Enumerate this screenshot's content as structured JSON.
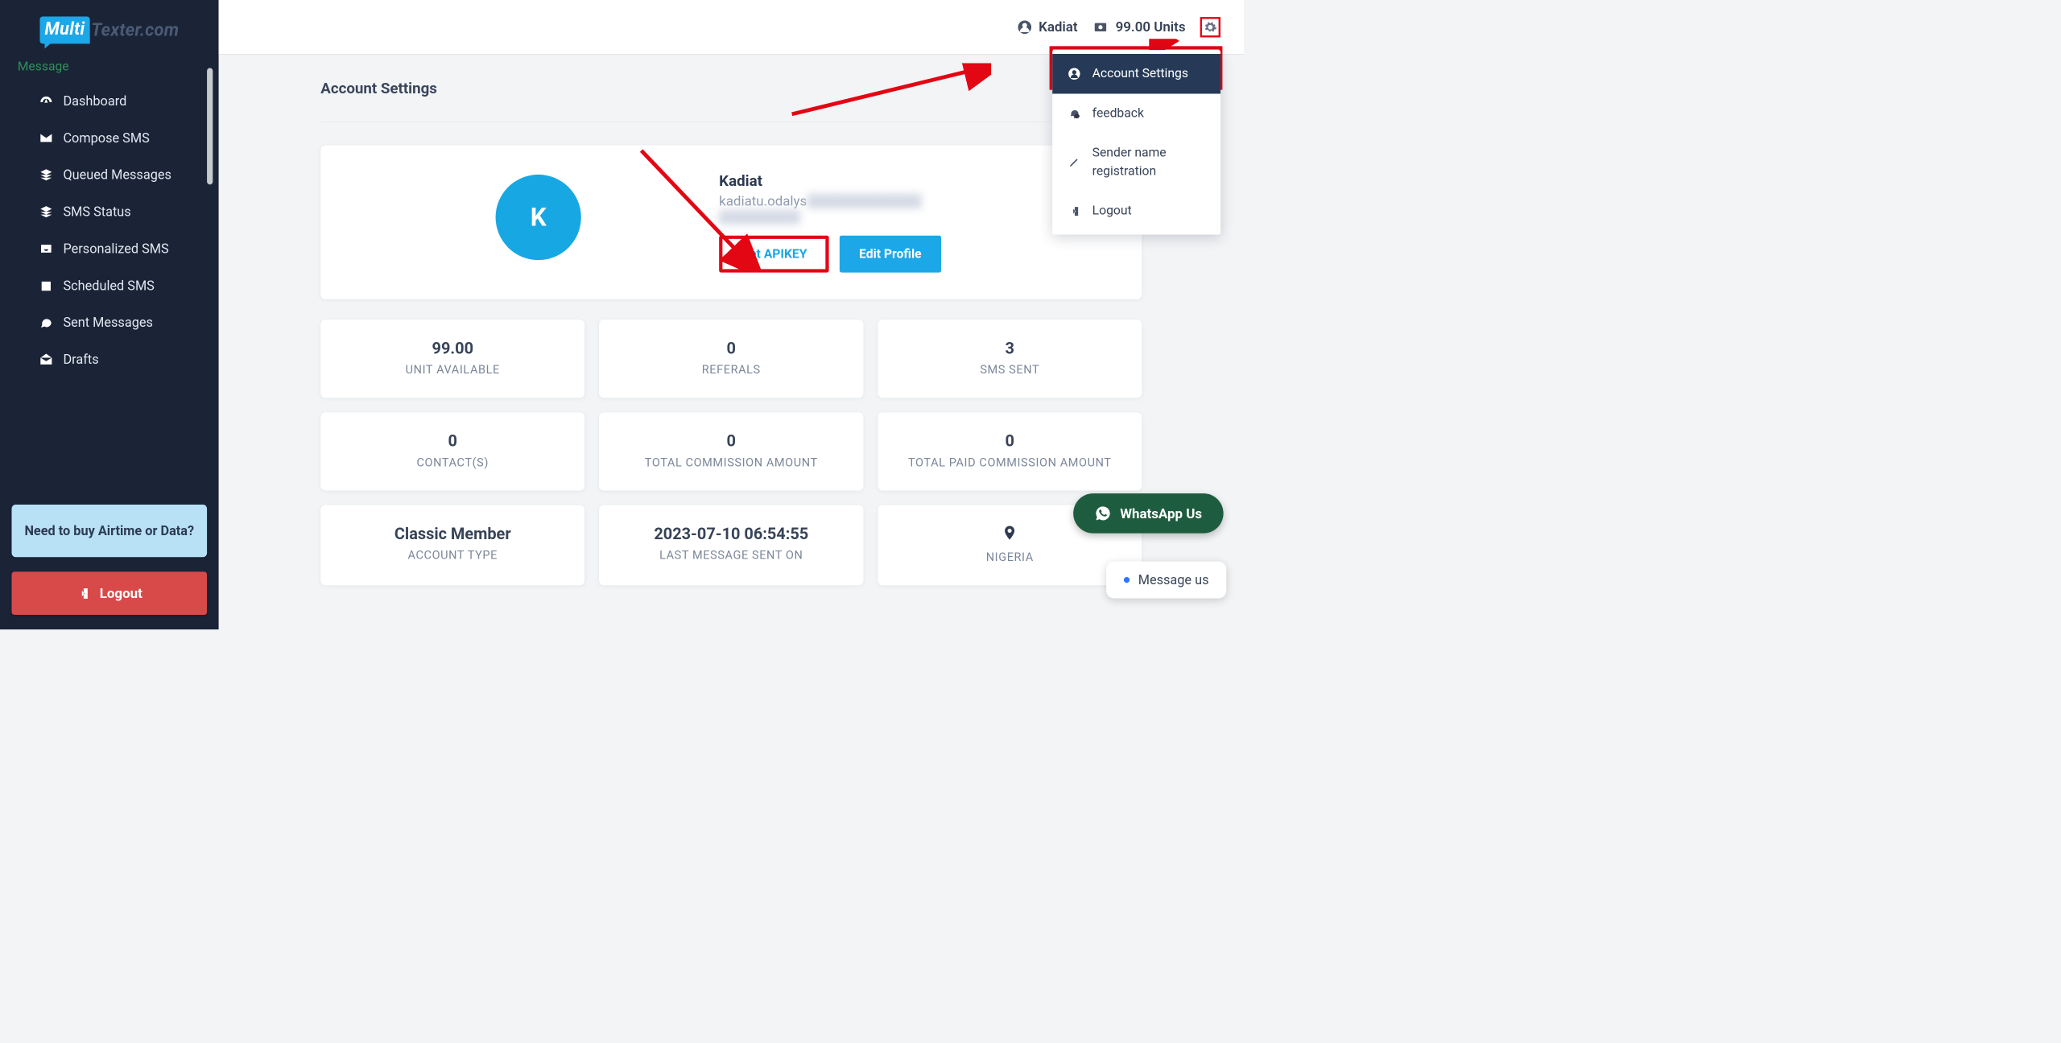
{
  "logo": {
    "left": "Multi",
    "right": "Texter.com"
  },
  "sidebar": {
    "section": "Message",
    "items": [
      {
        "icon": "gauge",
        "label": "Dashboard"
      },
      {
        "icon": "envelope",
        "label": "Compose SMS"
      },
      {
        "icon": "layers",
        "label": "Queued Messages"
      },
      {
        "icon": "layers",
        "label": "SMS Status"
      },
      {
        "icon": "inbox",
        "label": "Personalized SMS"
      },
      {
        "icon": "calendar",
        "label": "Scheduled SMS"
      },
      {
        "icon": "comment",
        "label": "Sent Messages"
      },
      {
        "icon": "envelope-open",
        "label": "Drafts"
      }
    ],
    "buy": "Need to buy Airtime or Data?",
    "logout": "Logout"
  },
  "topbar": {
    "user": "Kadiat",
    "units": "99.00 Units"
  },
  "page": {
    "title": "Account Settings",
    "profile": {
      "initial": "K",
      "name": "Kadiat",
      "email_prefix": "kadiatu.odalys",
      "get_api": "Get APIKEY",
      "edit": "Edit Profile"
    },
    "stats": [
      {
        "value": "99.00",
        "label": "UNIT AVAILABLE"
      },
      {
        "value": "0",
        "label": "REFERALS"
      },
      {
        "value": "3",
        "label": "SMS SENT"
      },
      {
        "value": "0",
        "label": "CONTACT(S)"
      },
      {
        "value": "0",
        "label": "TOTAL COMMISSION AMOUNT"
      },
      {
        "value": "0",
        "label": "TOTAL PAID COMMISSION AMOUNT"
      },
      {
        "value": "Classic Member",
        "label": "ACCOUNT TYPE"
      },
      {
        "value": "2023-07-10 06:54:55",
        "label": "LAST MESSAGE SENT ON"
      },
      {
        "value": "📍",
        "label": "NIGERIA",
        "is_location": true
      }
    ]
  },
  "dropdown": [
    {
      "icon": "user",
      "label": "Account Settings",
      "active": true
    },
    {
      "icon": "chat",
      "label": "feedback"
    },
    {
      "icon": "pen",
      "label": "Sender name registration"
    },
    {
      "icon": "signout",
      "label": "Logout"
    }
  ],
  "floats": {
    "whatsapp": "WhatsApp Us",
    "message": "Message us"
  }
}
